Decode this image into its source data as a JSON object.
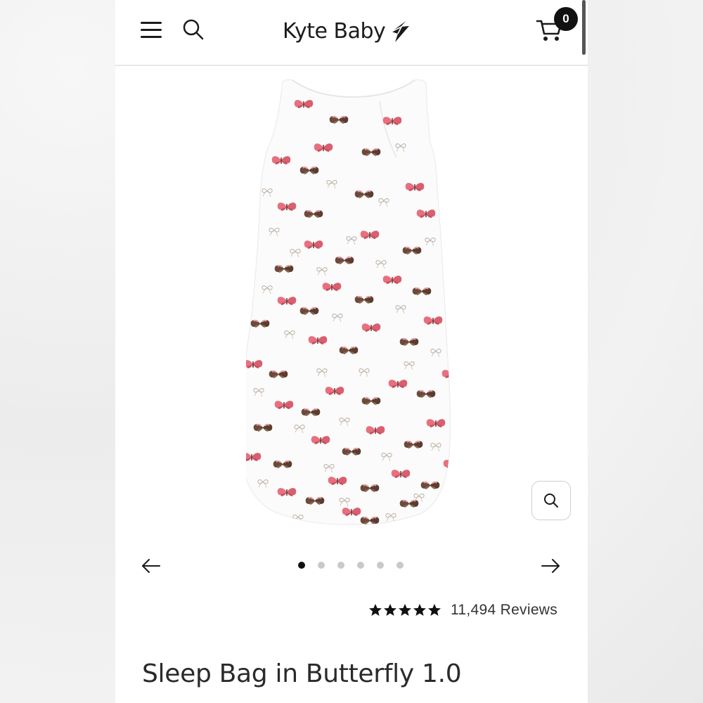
{
  "header": {
    "brand": "Kyte Baby",
    "cart_count": "0",
    "menu_icon": "hamburger-menu-icon",
    "search_icon": "search-icon",
    "cart_icon": "shopping-cart-icon"
  },
  "gallery": {
    "image_subject": "butterfly-print-sleep-bag",
    "zoom_icon": "magnifier-icon",
    "prev_icon": "arrow-left-icon",
    "next_icon": "arrow-right-icon",
    "slide_count": 6,
    "active_slide": 1
  },
  "product": {
    "rating_stars": 5,
    "reviews_label": "11,494 Reviews",
    "title": "Sleep Bag in Butterfly 1.0"
  },
  "colors": {
    "brand_dark": "#1b1b1b",
    "butterfly_pink": "#e06c78",
    "butterfly_brown": "#6b4a3a"
  }
}
